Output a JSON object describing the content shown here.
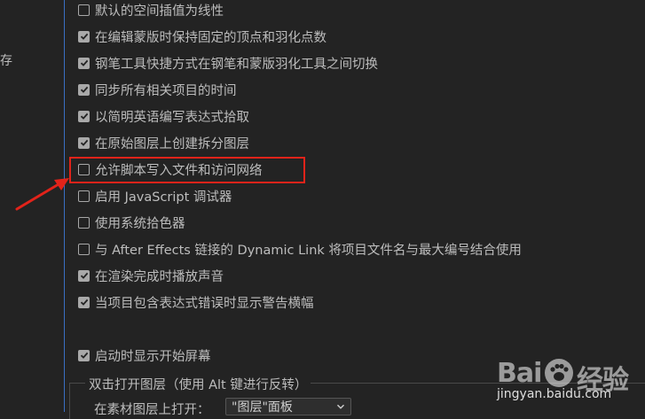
{
  "left_panel": {
    "partial_label": "存"
  },
  "options": [
    {
      "label": "默认的空间插值为线性",
      "checked": false
    },
    {
      "label": "在编辑蒙版时保持固定的顶点和羽化点数",
      "checked": true
    },
    {
      "label": "钢笔工具快捷方式在钢笔和蒙版羽化工具之间切换",
      "checked": true
    },
    {
      "label": "同步所有相关项目的时间",
      "checked": true
    },
    {
      "label": "以简明英语编写表达式拾取",
      "checked": true
    },
    {
      "label": "在原始图层上创建拆分图层",
      "checked": true
    },
    {
      "label": "允许脚本写入文件和访问网络",
      "checked": false
    },
    {
      "label": "启用 JavaScript 调试器",
      "checked": false
    },
    {
      "label": "使用系统拾色器",
      "checked": false
    },
    {
      "label": "与 After Effects 链接的 Dynamic Link 将项目文件名与最大编号结合使用",
      "checked": false
    },
    {
      "label": "在渲染完成时播放声音",
      "checked": true
    },
    {
      "label": "当项目包含表达式错误时显示警告横幅",
      "checked": true
    },
    {
      "label": "启动时显示开始屏幕",
      "checked": true
    }
  ],
  "double_click_group": {
    "title": "双击打开图层（使用 Alt 键进行反转）",
    "footage_label": "在素材图层上打开：",
    "footage_value": "\"图层\"面板"
  },
  "watermark": {
    "brand_left": "Bai",
    "brand_right": "经验",
    "url": "jingyan.baidu.com"
  },
  "colors": {
    "background": "#232323",
    "text": "#bdbdbd",
    "highlight": "#e2231a",
    "divider": "#3a6fc4"
  }
}
